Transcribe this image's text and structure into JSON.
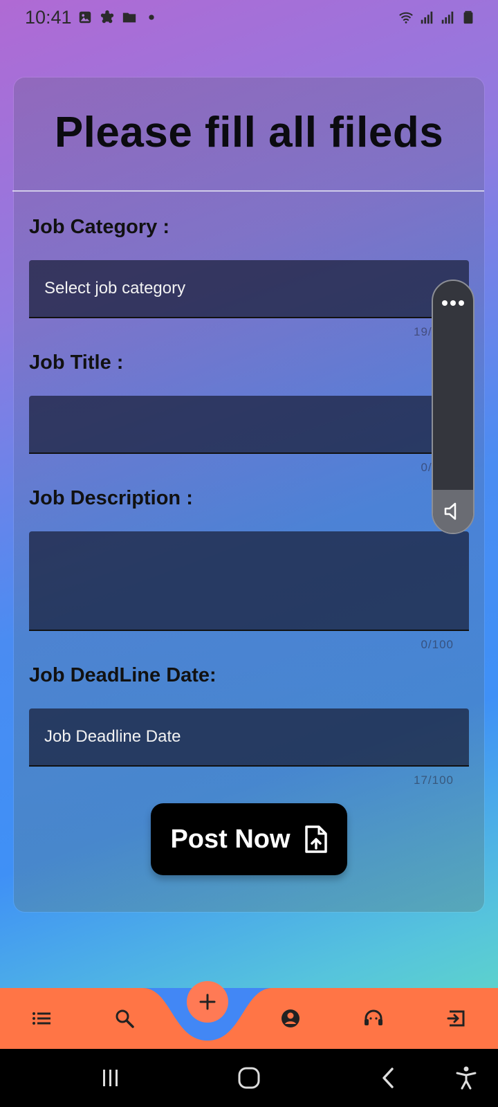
{
  "status_bar": {
    "time": "10:41",
    "left_icons": [
      "gallery-icon",
      "settings-icon",
      "folder-icon",
      "dot-icon"
    ],
    "right_icons": [
      "wifi-icon",
      "signal-icon",
      "signal-icon",
      "battery-icon"
    ]
  },
  "form": {
    "title": "Please fill all fileds",
    "fields": [
      {
        "label": "Job Category :",
        "value": "Select job category",
        "counter": "19/100"
      },
      {
        "label": "Job Title :",
        "value": "",
        "counter": "0/100"
      },
      {
        "label": "Job Description :",
        "value": "",
        "counter": "0/100"
      },
      {
        "label": "Job DeadLine Date:",
        "value": "Job Deadline Date",
        "counter": "17/100"
      }
    ],
    "submit_label": "Post Now",
    "submit_icon": "file-upload-icon"
  },
  "overlay": {
    "menu_icon": "more-horizontal-icon",
    "volume_icon": "volume-icon"
  },
  "bottom_nav": {
    "items": [
      "list-icon",
      "search-icon",
      "add-icon",
      "profile-icon",
      "support-icon",
      "logout-icon"
    ]
  },
  "system_nav": {
    "buttons": [
      "recents-icon",
      "home-icon",
      "back-icon",
      "accessibility-icon"
    ]
  },
  "colors": {
    "nav_bar": "#ff7546",
    "nav_notch": "#4287f5",
    "fab": "#ff7a55",
    "button": "#000000"
  }
}
